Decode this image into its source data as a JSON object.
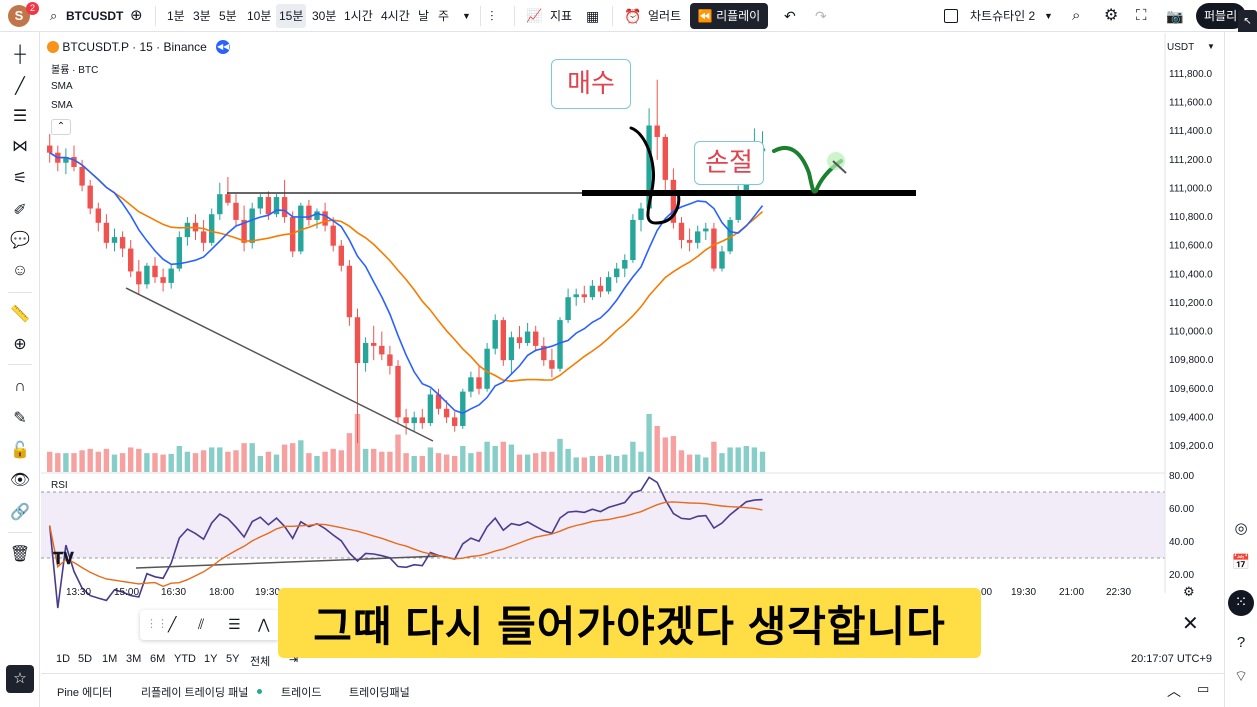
{
  "topbar": {
    "avatar_letter": "S",
    "avatar_badge": "2",
    "symbol": "BTCUSDT",
    "timeframes": [
      "1분",
      "3분",
      "5분",
      "10분",
      "15분",
      "30분",
      "1시간",
      "4시간",
      "날",
      "주"
    ],
    "active_timeframe_index": 4,
    "indicators_label": "지표",
    "alert_label": "얼러트",
    "replay_label": "리플레이",
    "layout_label": "차트슈타인 2",
    "publish_label": "퍼블리"
  },
  "legend": {
    "title": "BTCUSDT.P · 15 · Binance",
    "volume": "볼륨 · BTC",
    "sma1": "SMA",
    "sma2": "SMA",
    "currency": "USDT"
  },
  "annotations": {
    "buy": "매수",
    "stop": "손절"
  },
  "rsi_label": "RSI",
  "chart_data": {
    "type": "candlestick",
    "title": "BTCUSDT.P · 15 · Binance",
    "y_ticks": [
      "111,800.0",
      "111,600.0",
      "111,400.0",
      "111,200.0",
      "111,000.0",
      "110,800.0",
      "110,600.0",
      "110,400.0",
      "110,200.0",
      "110,000.0",
      "109,800.0",
      "109,600.0",
      "109,400.0",
      "109,200.0"
    ],
    "y_values": [
      111800,
      111600,
      111400,
      111200,
      111000,
      110800,
      110600,
      110400,
      110200,
      110000,
      109800,
      109600,
      109400,
      109200
    ],
    "rsi_ticks": [
      "80.00",
      "60.00",
      "40.00",
      "20.00"
    ],
    "x_ticks": [
      "13:30",
      "15:00",
      "16:30",
      "18:00",
      "19:30",
      "00",
      "19:30",
      "21:00",
      "22:30"
    ],
    "candles": [
      {
        "o": 111300,
        "h": 111380,
        "l": 111180,
        "c": 111250
      },
      {
        "o": 111250,
        "h": 111300,
        "l": 111120,
        "c": 111180
      },
      {
        "o": 111180,
        "h": 111280,
        "l": 111100,
        "c": 111220
      },
      {
        "o": 111220,
        "h": 111300,
        "l": 111120,
        "c": 111150
      },
      {
        "o": 111150,
        "h": 111200,
        "l": 110980,
        "c": 111020
      },
      {
        "o": 111020,
        "h": 111060,
        "l": 110820,
        "c": 110860
      },
      {
        "o": 110860,
        "h": 110900,
        "l": 110700,
        "c": 110760
      },
      {
        "o": 110760,
        "h": 110820,
        "l": 110580,
        "c": 110620
      },
      {
        "o": 110620,
        "h": 110720,
        "l": 110560,
        "c": 110660
      },
      {
        "o": 110660,
        "h": 110700,
        "l": 110520,
        "c": 110580
      },
      {
        "o": 110580,
        "h": 110640,
        "l": 110380,
        "c": 110420
      },
      {
        "o": 110420,
        "h": 110500,
        "l": 110260,
        "c": 110330
      },
      {
        "o": 110330,
        "h": 110480,
        "l": 110300,
        "c": 110460
      },
      {
        "o": 110460,
        "h": 110520,
        "l": 110340,
        "c": 110380
      },
      {
        "o": 110380,
        "h": 110440,
        "l": 110280,
        "c": 110340
      },
      {
        "o": 110340,
        "h": 110470,
        "l": 110300,
        "c": 110440
      },
      {
        "o": 110440,
        "h": 110700,
        "l": 110420,
        "c": 110660
      },
      {
        "o": 110660,
        "h": 110800,
        "l": 110600,
        "c": 110760
      },
      {
        "o": 110760,
        "h": 110820,
        "l": 110640,
        "c": 110700
      },
      {
        "o": 110700,
        "h": 110780,
        "l": 110560,
        "c": 110620
      },
      {
        "o": 110620,
        "h": 110860,
        "l": 110600,
        "c": 110820
      },
      {
        "o": 110820,
        "h": 111040,
        "l": 110780,
        "c": 110960
      },
      {
        "o": 110960,
        "h": 111080,
        "l": 110880,
        "c": 110900
      },
      {
        "o": 110900,
        "h": 110960,
        "l": 110740,
        "c": 110780
      },
      {
        "o": 110780,
        "h": 110880,
        "l": 110560,
        "c": 110620
      },
      {
        "o": 110620,
        "h": 110900,
        "l": 110580,
        "c": 110860
      },
      {
        "o": 110860,
        "h": 110960,
        "l": 110820,
        "c": 110940
      },
      {
        "o": 110940,
        "h": 110980,
        "l": 110780,
        "c": 110820
      },
      {
        "o": 110820,
        "h": 110960,
        "l": 110800,
        "c": 110940
      },
      {
        "o": 110940,
        "h": 111060,
        "l": 110760,
        "c": 110800
      },
      {
        "o": 110800,
        "h": 110840,
        "l": 110520,
        "c": 110560
      },
      {
        "o": 110560,
        "h": 110900,
        "l": 110540,
        "c": 110880
      },
      {
        "o": 110880,
        "h": 110920,
        "l": 110740,
        "c": 110780
      },
      {
        "o": 110780,
        "h": 110860,
        "l": 110720,
        "c": 110840
      },
      {
        "o": 110840,
        "h": 110900,
        "l": 110700,
        "c": 110740
      },
      {
        "o": 110740,
        "h": 110800,
        "l": 110560,
        "c": 110600
      },
      {
        "o": 110600,
        "h": 110640,
        "l": 110420,
        "c": 110460
      },
      {
        "o": 110460,
        "h": 110500,
        "l": 110040,
        "c": 110100
      },
      {
        "o": 110100,
        "h": 110160,
        "l": 109220,
        "c": 109780
      },
      {
        "o": 109780,
        "h": 109960,
        "l": 109720,
        "c": 109920
      },
      {
        "o": 109920,
        "h": 110040,
        "l": 109800,
        "c": 109900
      },
      {
        "o": 109900,
        "h": 110000,
        "l": 109800,
        "c": 109840
      },
      {
        "o": 109840,
        "h": 109900,
        "l": 109700,
        "c": 109760
      },
      {
        "o": 109760,
        "h": 109800,
        "l": 109360,
        "c": 109400
      },
      {
        "o": 109400,
        "h": 109460,
        "l": 109280,
        "c": 109360
      },
      {
        "o": 109360,
        "h": 109440,
        "l": 109300,
        "c": 109400
      },
      {
        "o": 109400,
        "h": 109460,
        "l": 109320,
        "c": 109360
      },
      {
        "o": 109360,
        "h": 109600,
        "l": 109340,
        "c": 109560
      },
      {
        "o": 109560,
        "h": 109600,
        "l": 109420,
        "c": 109460
      },
      {
        "o": 109460,
        "h": 109520,
        "l": 109360,
        "c": 109400
      },
      {
        "o": 109400,
        "h": 109440,
        "l": 109300,
        "c": 109340
      },
      {
        "o": 109340,
        "h": 109600,
        "l": 109320,
        "c": 109580
      },
      {
        "o": 109580,
        "h": 109720,
        "l": 109540,
        "c": 109680
      },
      {
        "o": 109680,
        "h": 109760,
        "l": 109560,
        "c": 109600
      },
      {
        "o": 109600,
        "h": 109920,
        "l": 109580,
        "c": 109880
      },
      {
        "o": 109880,
        "h": 110120,
        "l": 109840,
        "c": 110080
      },
      {
        "o": 110080,
        "h": 110100,
        "l": 109760,
        "c": 109800
      },
      {
        "o": 109800,
        "h": 110000,
        "l": 109700,
        "c": 109960
      },
      {
        "o": 109960,
        "h": 110040,
        "l": 109880,
        "c": 109920
      },
      {
        "o": 109920,
        "h": 110060,
        "l": 109900,
        "c": 110000
      },
      {
        "o": 110000,
        "h": 110040,
        "l": 109860,
        "c": 109900
      },
      {
        "o": 109900,
        "h": 109960,
        "l": 109760,
        "c": 109800
      },
      {
        "o": 109800,
        "h": 109880,
        "l": 109680,
        "c": 109740
      },
      {
        "o": 109740,
        "h": 110100,
        "l": 109720,
        "c": 110080
      },
      {
        "o": 110080,
        "h": 110300,
        "l": 110060,
        "c": 110240
      },
      {
        "o": 110240,
        "h": 110300,
        "l": 110180,
        "c": 110260
      },
      {
        "o": 110260,
        "h": 110320,
        "l": 110200,
        "c": 110240
      },
      {
        "o": 110240,
        "h": 110360,
        "l": 110220,
        "c": 110320
      },
      {
        "o": 110320,
        "h": 110380,
        "l": 110240,
        "c": 110280
      },
      {
        "o": 110280,
        "h": 110420,
        "l": 110260,
        "c": 110380
      },
      {
        "o": 110380,
        "h": 110480,
        "l": 110340,
        "c": 110440
      },
      {
        "o": 110440,
        "h": 110540,
        "l": 110380,
        "c": 110500
      },
      {
        "o": 110500,
        "h": 110820,
        "l": 110480,
        "c": 110780
      },
      {
        "o": 110780,
        "h": 110900,
        "l": 110700,
        "c": 110860
      },
      {
        "o": 110860,
        "h": 111560,
        "l": 110820,
        "c": 111440
      },
      {
        "o": 111440,
        "h": 111760,
        "l": 111200,
        "c": 111360
      },
      {
        "o": 111360,
        "h": 111380,
        "l": 110980,
        "c": 111060
      },
      {
        "o": 111060,
        "h": 111140,
        "l": 110720,
        "c": 110760
      },
      {
        "o": 110760,
        "h": 110800,
        "l": 110580,
        "c": 110640
      },
      {
        "o": 110640,
        "h": 110720,
        "l": 110560,
        "c": 110620
      },
      {
        "o": 110620,
        "h": 110740,
        "l": 110580,
        "c": 110700
      },
      {
        "o": 110700,
        "h": 110760,
        "l": 110640,
        "c": 110720
      },
      {
        "o": 110720,
        "h": 110760,
        "l": 110420,
        "c": 110440
      },
      {
        "o": 110440,
        "h": 110600,
        "l": 110420,
        "c": 110560
      },
      {
        "o": 110560,
        "h": 110800,
        "l": 110540,
        "c": 110780
      },
      {
        "o": 110780,
        "h": 111020,
        "l": 110760,
        "c": 110980
      },
      {
        "o": 110980,
        "h": 111240,
        "l": 110960,
        "c": 111200
      },
      {
        "o": 111200,
        "h": 111420,
        "l": 111160,
        "c": 111260
      },
      {
        "o": 111260,
        "h": 111400,
        "l": 111200,
        "c": 111280
      }
    ],
    "horizontal_levels": [
      111000
    ],
    "rsi_overbought": 70,
    "rsi_oversold": 30
  },
  "timebar": {
    "ranges": [
      "1D",
      "5D",
      "1M",
      "3M",
      "6M",
      "YTD",
      "1Y",
      "5Y",
      "전체"
    ],
    "clock": "20:17:07 UTC+9"
  },
  "bottom_tabs": [
    "Pine 에디터",
    "리플레이 트레이딩 패널",
    "트레이드",
    "트레이딩패널"
  ],
  "subtitle": "그때 다시 들어가야겠다 생각합니다",
  "colors": {
    "up": "#26a69a",
    "down": "#ef5350",
    "sma_fast": "#2962ff",
    "sma_slow": "#f57c00",
    "rsi_line": "#4a3b8c",
    "rsi_ma": "#e86a1a",
    "subtitle_bg": "#ffde45"
  }
}
